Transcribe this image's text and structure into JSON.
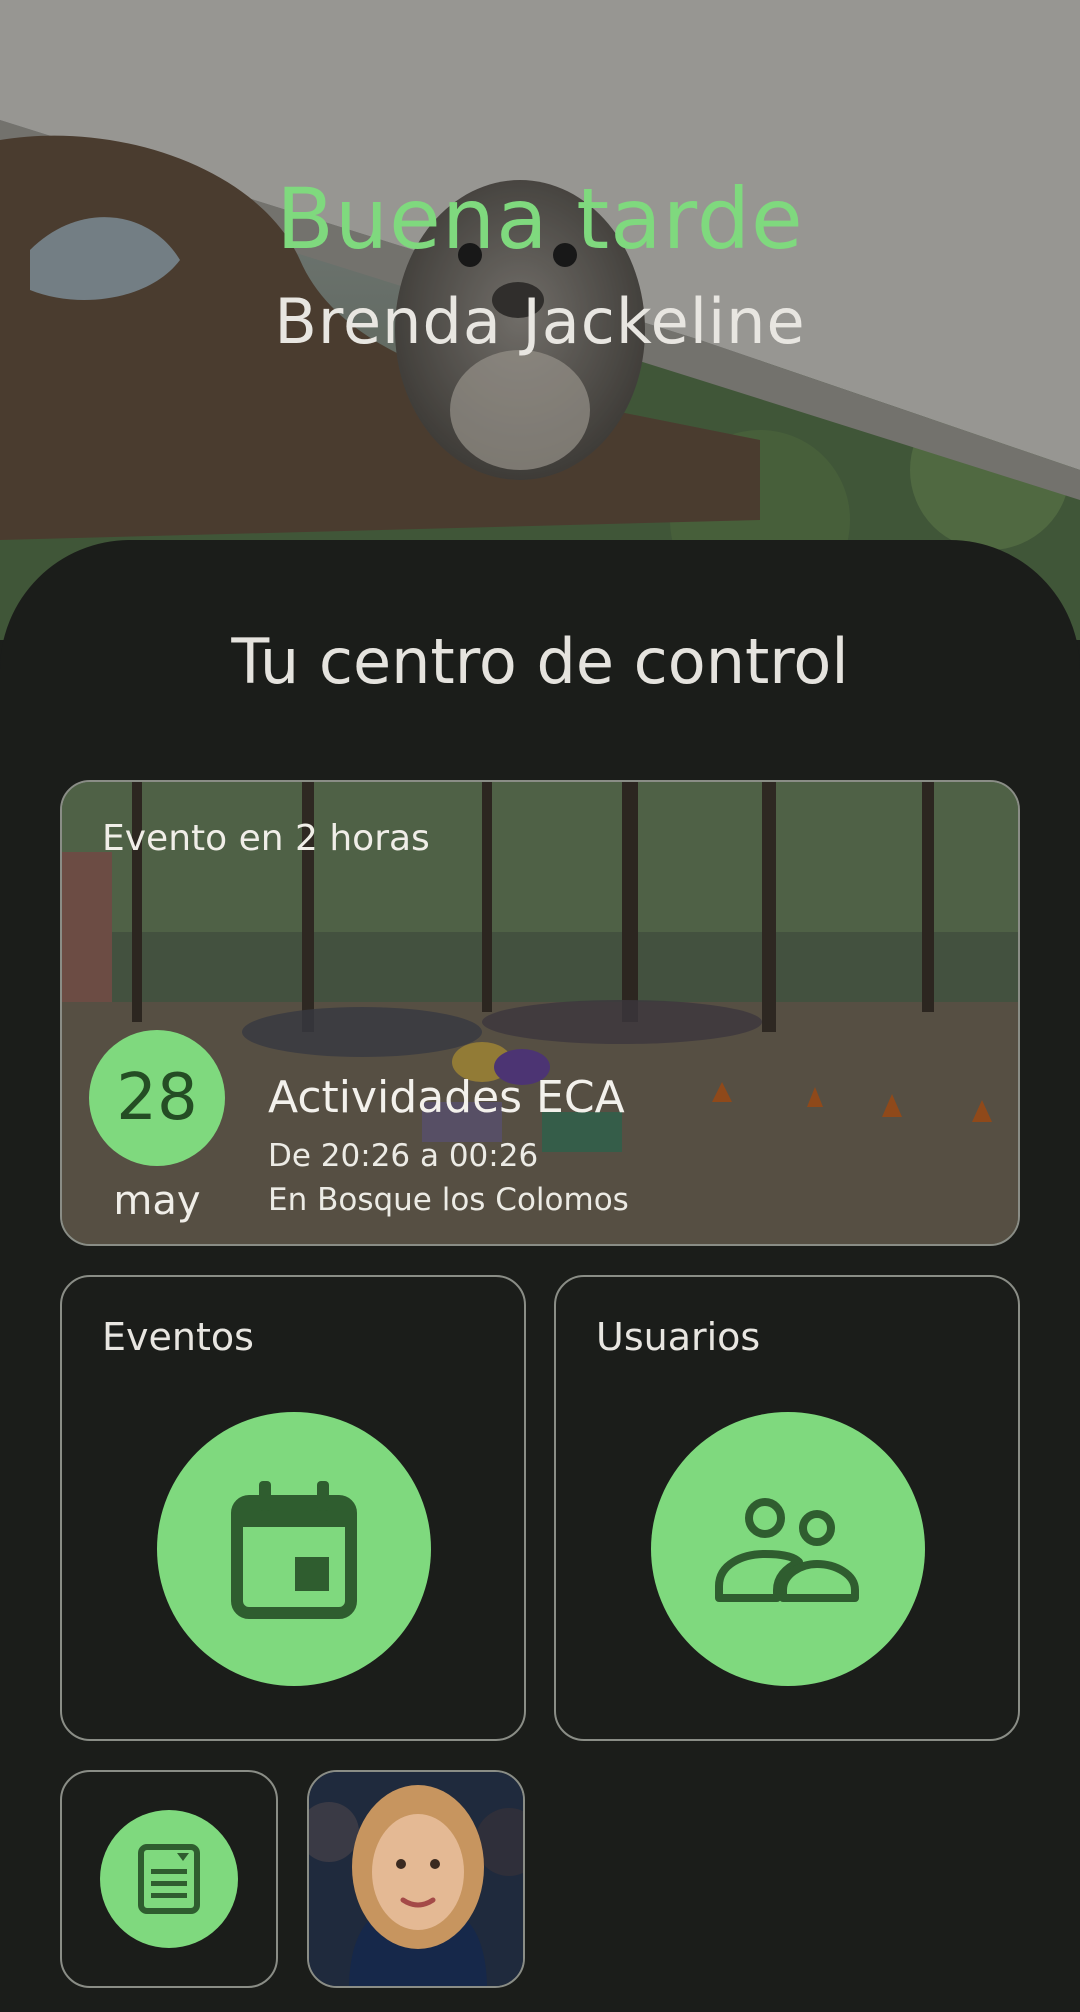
{
  "greeting": {
    "title": "Buena tarde",
    "name": "Brenda Jackeline"
  },
  "control_center": {
    "title": "Tu centro de control"
  },
  "next_event": {
    "eyebrow": "Evento en 2 horas",
    "day": "28",
    "month": "may",
    "name": "Actividades ECA",
    "time": "De 20:26 a 00:26",
    "place": "En Bosque los Colomos"
  },
  "tiles": {
    "events": {
      "label": "Eventos",
      "icon": "calendar-icon"
    },
    "users": {
      "label": "Usuarios",
      "icon": "users-icon"
    },
    "forms": {
      "icon": "form-icon"
    },
    "profile": {
      "icon": "avatar"
    }
  },
  "colors": {
    "accent": "#7fd97e",
    "accent_dark": "#2f5d2f",
    "background": "#1b1d1a",
    "border": "#8a8d86",
    "text": "#e8e6e1"
  }
}
